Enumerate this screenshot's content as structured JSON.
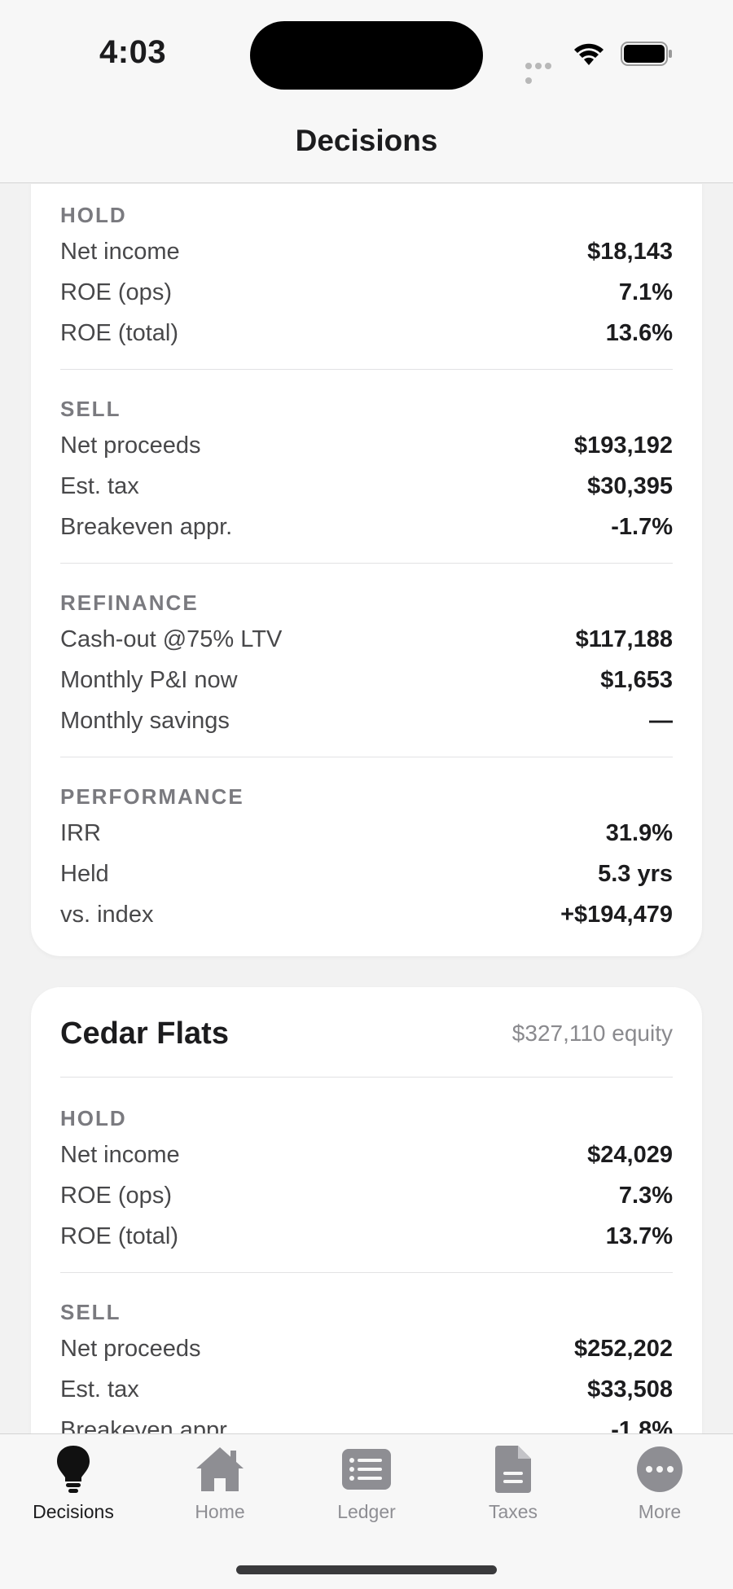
{
  "status": {
    "time": "4:03"
  },
  "nav": {
    "title": "Decisions"
  },
  "card_a": {
    "hold": {
      "title": "HOLD",
      "rows": [
        {
          "label": "Net income",
          "value": "$18,143"
        },
        {
          "label": "ROE (ops)",
          "value": "7.1%"
        },
        {
          "label": "ROE (total)",
          "value": "13.6%"
        }
      ]
    },
    "sell": {
      "title": "SELL",
      "rows": [
        {
          "label": "Net proceeds",
          "value": "$193,192"
        },
        {
          "label": "Est. tax",
          "value": "$30,395"
        },
        {
          "label": "Breakeven appr.",
          "value": "-1.7%"
        }
      ]
    },
    "refinance": {
      "title": "REFINANCE",
      "rows": [
        {
          "label": "Cash-out @75% LTV",
          "value": "$117,188"
        },
        {
          "label": "Monthly P&I now",
          "value": "$1,653"
        },
        {
          "label": "Monthly savings",
          "value": "—"
        }
      ]
    },
    "performance": {
      "title": "PERFORMANCE",
      "rows": [
        {
          "label": "IRR",
          "value": "31.9%"
        },
        {
          "label": "Held",
          "value": "5.3 yrs"
        },
        {
          "label": "vs. index",
          "value": "+$194,479"
        }
      ]
    }
  },
  "card_b": {
    "name": "Cedar Flats",
    "equity": "$327,110 equity",
    "hold": {
      "title": "HOLD",
      "rows": [
        {
          "label": "Net income",
          "value": "$24,029"
        },
        {
          "label": "ROE (ops)",
          "value": "7.3%"
        },
        {
          "label": "ROE (total)",
          "value": "13.7%"
        }
      ]
    },
    "sell": {
      "title": "SELL",
      "rows": [
        {
          "label": "Net proceeds",
          "value": "$252,202"
        },
        {
          "label": "Est. tax",
          "value": "$33,508"
        },
        {
          "label": "Breakeven appr.",
          "value": "-1.8%"
        }
      ]
    }
  },
  "tabs": [
    {
      "label": "Decisions",
      "icon": "lightbulb-icon",
      "active": true
    },
    {
      "label": "Home",
      "icon": "house-icon",
      "active": false
    },
    {
      "label": "Ledger",
      "icon": "list-icon",
      "active": false
    },
    {
      "label": "Taxes",
      "icon": "document-icon",
      "active": false
    },
    {
      "label": "More",
      "icon": "ellipsis-circle-icon",
      "active": false
    }
  ]
}
